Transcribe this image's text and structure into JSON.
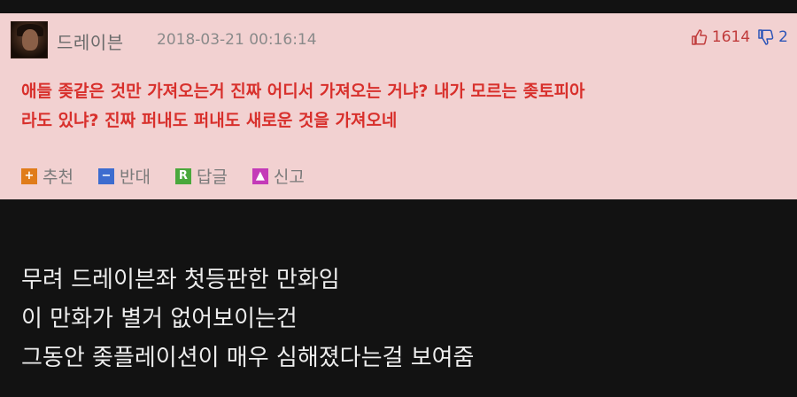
{
  "comment": {
    "author": "드레이븐",
    "timestamp": "2018-03-21 00:16:14",
    "upvotes": "1614",
    "downvotes": "2",
    "body_lines": [
      "애들 좆같은 것만 가져오는거 진짜 어디서 가져오는 거냐? 내가 모르는 좆토피아",
      "라도 있냐? 진짜 퍼내도 퍼내도 새로운 것을 가져오네"
    ],
    "actions": {
      "recommend": "추천",
      "oppose": "반대",
      "reply": "답글",
      "report": "신고"
    },
    "icons": {
      "upvote": "thumbs-up-icon",
      "downvote": "thumbs-down-icon",
      "recommend": "plus-icon",
      "oppose": "minus-icon",
      "reply": "r-icon",
      "report": "alert-icon"
    },
    "colors": {
      "card_bg": "#f2d1d1",
      "body_text": "#d8302c"
    }
  },
  "post_text": {
    "lines": [
      "무려 드레이븐좌 첫등판한 만화임",
      "이 만화가 별거 없어보이는건",
      "그동안 좆플레이션이 매우 심해졌다는걸 보여줌"
    ]
  }
}
